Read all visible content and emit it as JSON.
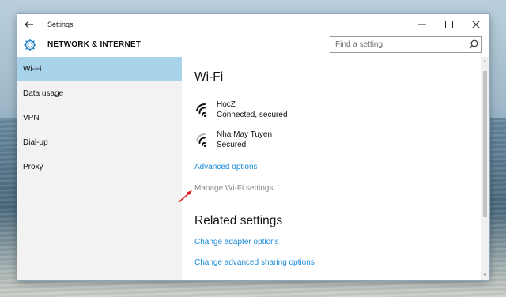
{
  "window": {
    "title": "Settings",
    "back_icon": "arrow-left-icon",
    "controls": [
      "minimize-icon",
      "maximize-icon",
      "close-icon"
    ]
  },
  "header": {
    "icon": "gear-icon",
    "title": "NETWORK & INTERNET",
    "search_placeholder": "Find a setting",
    "search_value": ""
  },
  "sidebar": {
    "items": [
      {
        "label": "Wi-Fi",
        "active": true
      },
      {
        "label": "Data usage",
        "active": false
      },
      {
        "label": "VPN",
        "active": false
      },
      {
        "label": "Dial-up",
        "active": false
      },
      {
        "label": "Proxy",
        "active": false
      }
    ]
  },
  "main": {
    "heading": "Wi-Fi",
    "networks": [
      {
        "name": "HocZ",
        "status": "Connected, secured",
        "icon": "wifi-full-icon"
      },
      {
        "name": "Nha May Tuyen",
        "status": "Secured",
        "icon": "wifi-medium-icon"
      }
    ],
    "advanced_options": "Advanced options",
    "manage_wifi": "Manage Wi-Fi settings",
    "related_heading": "Related settings",
    "related_links": [
      "Change adapter options",
      "Change advanced sharing options"
    ]
  },
  "colors": {
    "accent_link": "#1a8ad9",
    "sidebar_active": "#a9d3ea",
    "annotation_arrow": "#e0201e"
  }
}
